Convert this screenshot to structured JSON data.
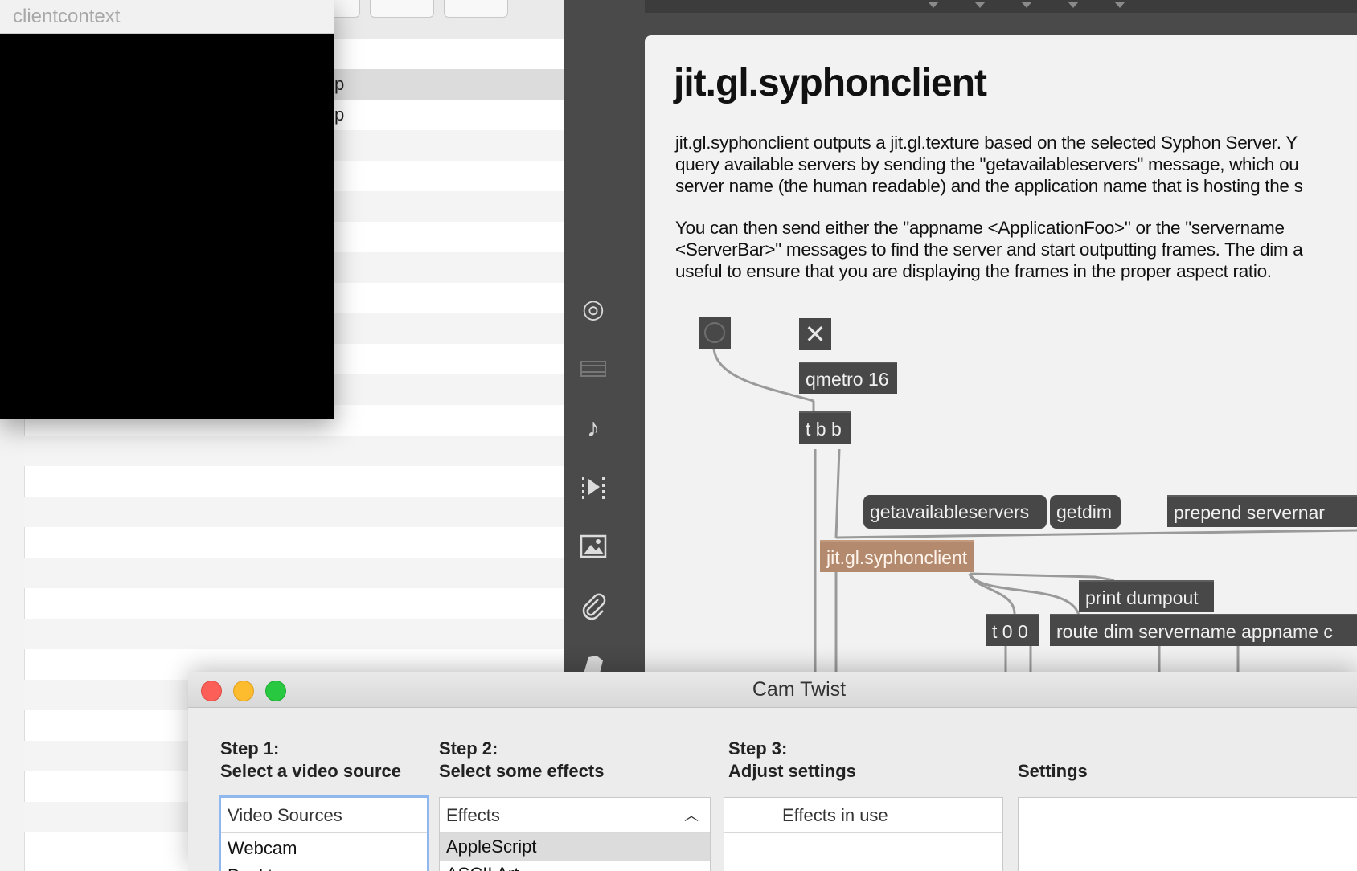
{
  "list_window": {
    "rows": [
      {
        "text": "p",
        "selected": true
      },
      {
        "text": "p",
        "selected": false
      }
    ]
  },
  "clientcontext": {
    "title": "clientcontext"
  },
  "max": {
    "help_title": "jit.gl.syphonclient",
    "paragraph1": [
      "jit.gl.syphonclient outputs a jit.gl.texture based on the selected Syphon Server. Y",
      "query available servers by sending the \"getavailableservers\" message, which ou",
      "server name (the human readable) and the application name that is hosting the s"
    ],
    "paragraph2": [
      "You can then send either the \"appname <ApplicationFoo>\" or the \"servername",
      "<ServerBar>\" messages to find the server and start outputting frames. The dim a",
      "useful to ensure that you are displaying the frames in the proper aspect ratio."
    ],
    "toggle_glyph": "✕",
    "objects": {
      "qmetro": "qmetro 16",
      "tbb": "t b b",
      "getavailableservers": "getavailableservers",
      "getdim": "getdim",
      "prepend": "prepend servernar",
      "syphonclient": "jit.gl.syphonclient",
      "print": "print dumpout",
      "t00": "t 0 0",
      "route": "route dim servername appname c"
    },
    "sidebar_icons": [
      "target-icon",
      "film-icon",
      "music-note-icon",
      "media-icon",
      "image-icon",
      "paperclip-icon",
      "extras-icon"
    ],
    "colors": {
      "accent_object": "#b38a6e",
      "patch_bg": "#f2f2f2",
      "sidebar": "#4a4a4a"
    }
  },
  "camtwist": {
    "title": "Cam Twist",
    "step1": {
      "heading": "Step 1:",
      "desc": "Select a video source"
    },
    "step2": {
      "heading": "Step 2:",
      "desc": "Select some effects"
    },
    "step3": {
      "heading": "Step 3:",
      "desc": "Adjust settings"
    },
    "settings_label": "Settings",
    "video_sources": {
      "header": "Video Sources",
      "items": [
        "Webcam",
        "Desktop"
      ]
    },
    "effects": {
      "header": "Effects",
      "items": [
        "AppleScript",
        "ASCII Art"
      ]
    },
    "effects_in_use": {
      "header": "Effects in use"
    }
  }
}
